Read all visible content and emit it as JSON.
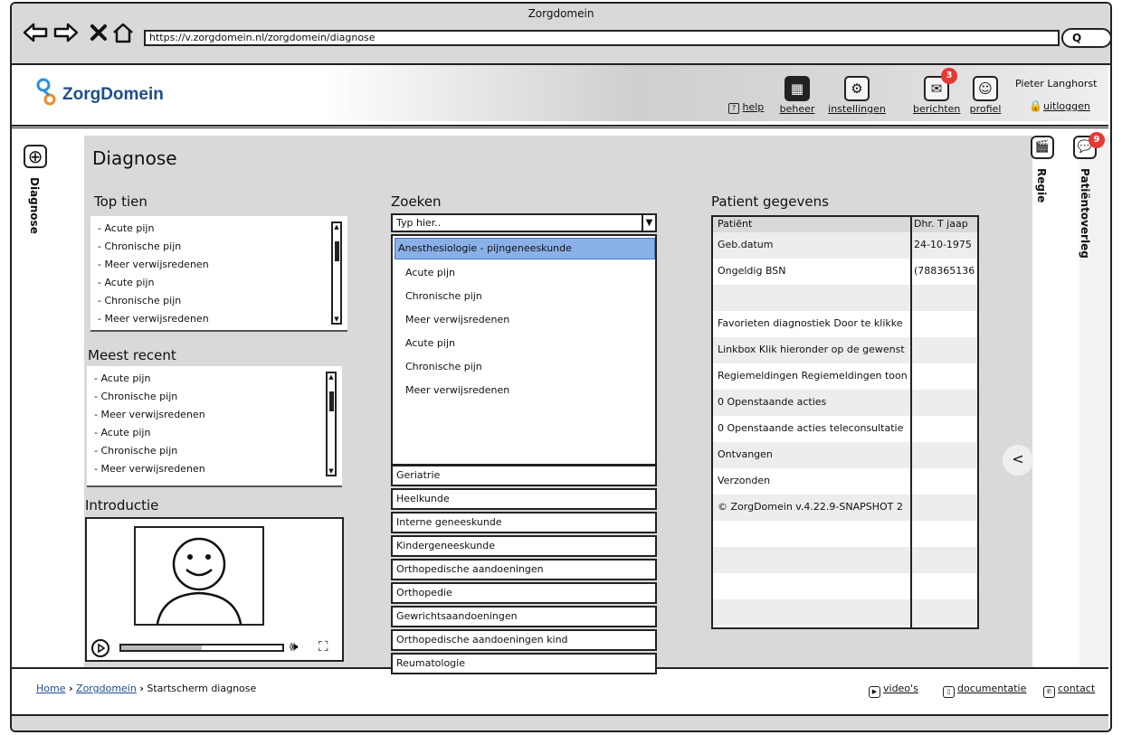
{
  "window": {
    "title": "Zorgdomein",
    "url": "https://v.zorgdomein.nl/zorgdomein/diagnose",
    "search_glyph": "Q"
  },
  "header": {
    "logo_text": "ZorgDomein",
    "nav": {
      "help": "help",
      "beheer": "beheer",
      "instellingen": "instellingen",
      "berichten": "berichten",
      "profiel": "profiel"
    },
    "berichten_badge": "3",
    "user_name": "Pieter Langhorst",
    "logout": "uitloggen"
  },
  "left_rail": {
    "label": "Diagnose"
  },
  "page": {
    "title": "Diagnose"
  },
  "top_tien": {
    "title": "Top tien",
    "items": [
      "- Acute pijn",
      "- Chronische pijn",
      "- Meer verwijsredenen",
      "- Acute pijn",
      "- Chronische pijn",
      "- Meer verwijsredenen"
    ]
  },
  "meest_recent": {
    "title": "Meest recent",
    "items": [
      "- Acute pijn",
      "- Chronische pijn",
      "- Meer verwijsredenen",
      "- Acute pijn",
      "- Chronische pijn",
      "- Meer verwijsredenen"
    ]
  },
  "introductie": {
    "title": "Introductie",
    "video_progress": 0.5
  },
  "zoeken": {
    "title": "Zoeken",
    "placeholder": "Typ hier..",
    "selected_group": "Anesthesiologie - pijngeneeskunde",
    "sub_items": [
      "Acute pijn",
      "Chronische pijn",
      "Meer verwijsredenen",
      "Acute pijn",
      "Chronische pijn",
      "Meer verwijsredenen"
    ],
    "specialisms": [
      "Geriatrie",
      "Heelkunde",
      "Interne geneeskunde",
      "Kindergeneeskunde",
      "Orthopedische aandoeningen",
      "Orthopedie",
      "Gewrichtsaandoeningen",
      "Orthopedische aandoeningen kind",
      "Reumatologie"
    ]
  },
  "patient": {
    "title": "Patient gegevens",
    "rows": [
      {
        "left": "Patiënt",
        "right": "Dhr. T jaap"
      },
      {
        "left": "Geb.datum",
        "right": "24-10-1975"
      },
      {
        "left": "Ongeldig BSN",
        "right": "(788365136"
      },
      {
        "left": "",
        "right": ""
      },
      {
        "left": "Favorieten diagnostiek  Door te klikke",
        "right": ""
      },
      {
        "left": "Linkbox  Klik hieronder op de gewenst",
        "right": ""
      },
      {
        "left": "Regiemeldingen  Regiemeldingen toon",
        "right": ""
      },
      {
        "left": "0 Openstaande acties",
        "right": ""
      },
      {
        "left": "0 Openstaande acties teleconsultatie",
        "right": ""
      },
      {
        "left": "Ontvangen",
        "right": ""
      },
      {
        "left": "Verzonden",
        "right": ""
      },
      {
        "left": "© ZorgDomein v.4.22.9-SNAPSHOT 2",
        "right": ""
      },
      {
        "left": "",
        "right": ""
      },
      {
        "left": "",
        "right": ""
      },
      {
        "left": "",
        "right": ""
      },
      {
        "left": "",
        "right": ""
      }
    ]
  },
  "collapse_glyph": "<",
  "right_rails": {
    "regie": "Regie",
    "overleg": "Patiëntoverleg",
    "overleg_badge": "9"
  },
  "footer": {
    "breadcrumb": {
      "home": "Home",
      "zorgdomein": "Zorgdomein",
      "current": "Startscherm diagnose",
      "sep": "›"
    },
    "videos": "video's",
    "documentatie": "documentatie",
    "contact": "contact"
  }
}
